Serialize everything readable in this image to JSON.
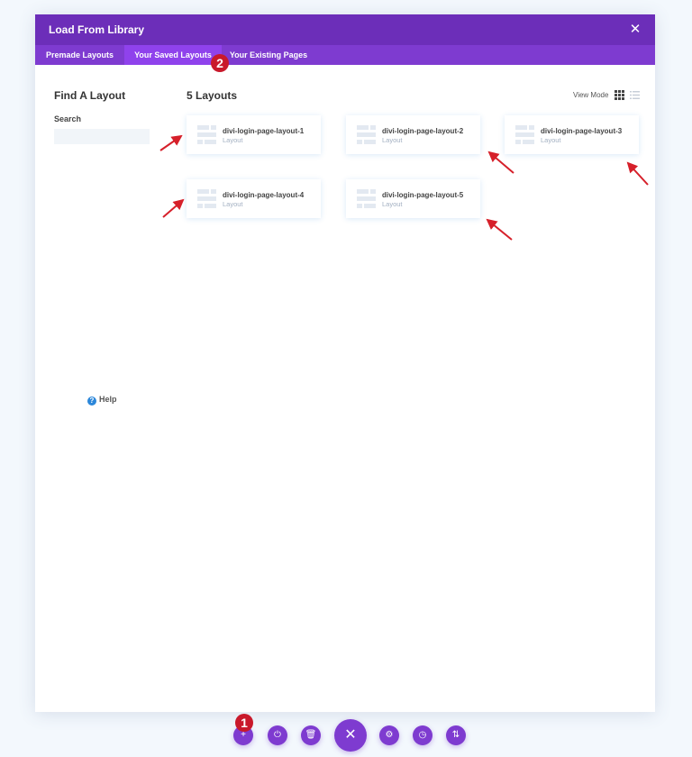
{
  "modal": {
    "title": "Load From Library",
    "close_glyph": "✕"
  },
  "tabs": [
    {
      "label": "Premade Layouts",
      "active": false
    },
    {
      "label": "Your Saved Layouts",
      "active": true
    },
    {
      "label": "Your Existing Pages",
      "active": false
    }
  ],
  "badges": {
    "tab_step": "2",
    "toolbar_step": "1"
  },
  "sidebar": {
    "title": "Find A Layout",
    "search_label": "Search",
    "search_value": "",
    "help_label": "Help",
    "help_glyph": "?"
  },
  "main": {
    "count_title": "5 Layouts",
    "view_mode_label": "View Mode"
  },
  "layouts": [
    {
      "name": "divi-login-page-layout-1",
      "type": "Layout"
    },
    {
      "name": "divi-login-page-layout-2",
      "type": "Layout"
    },
    {
      "name": "divi-login-page-layout-3",
      "type": "Layout"
    },
    {
      "name": "divi-login-page-layout-4",
      "type": "Layout"
    },
    {
      "name": "divi-login-page-layout-5",
      "type": "Layout"
    }
  ],
  "toolbar": [
    {
      "icon": "plus-icon",
      "glyph": "+"
    },
    {
      "icon": "power-icon",
      "glyph": "⏻"
    },
    {
      "icon": "trash-icon",
      "glyph": "🗑"
    },
    {
      "icon": "close-icon",
      "glyph": "✕"
    },
    {
      "icon": "gear-icon",
      "glyph": "⚙"
    },
    {
      "icon": "history-icon",
      "glyph": "◷"
    },
    {
      "icon": "sort-icon",
      "glyph": "⇅"
    }
  ],
  "colors": {
    "header": "#6c2eb9",
    "tabs": "#7e3bd0",
    "accent": "#8f42ec",
    "badge": "#c9192b",
    "arrow": "#d6202a"
  }
}
